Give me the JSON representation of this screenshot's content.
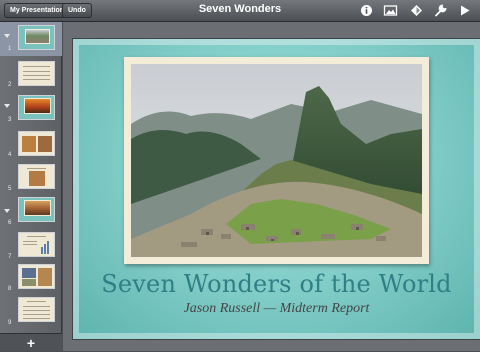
{
  "toolbar": {
    "my_presentations_label": "My Presentations",
    "undo_label": "Undo",
    "title": "Seven Wonders",
    "icons": [
      "info-icon",
      "media-icon",
      "animation-icon",
      "tools-icon",
      "play-icon"
    ]
  },
  "sidebar": {
    "slides": [
      {
        "number": "1",
        "selected": true,
        "group": true,
        "style": "teal-photo"
      },
      {
        "number": "2",
        "selected": false,
        "group": false,
        "style": "cream-text"
      },
      {
        "number": "3",
        "selected": false,
        "group": true,
        "style": "orange-photo"
      },
      {
        "number": "4",
        "selected": false,
        "group": false,
        "style": "cream-photos"
      },
      {
        "number": "5",
        "selected": false,
        "group": false,
        "style": "cream-photo"
      },
      {
        "number": "6",
        "selected": false,
        "group": true,
        "style": "teal-photo"
      },
      {
        "number": "7",
        "selected": false,
        "group": false,
        "style": "cream-chart"
      },
      {
        "number": "8",
        "selected": false,
        "group": false,
        "style": "cream-photos"
      },
      {
        "number": "9",
        "selected": false,
        "group": false,
        "style": "cream-text"
      }
    ],
    "add_label": "+"
  },
  "slide": {
    "title": "Seven Wonders of the World",
    "subtitle": "Jason Russell — Midterm Report",
    "accent_color": "#7fcbc6",
    "title_color": "#2f7f86"
  }
}
